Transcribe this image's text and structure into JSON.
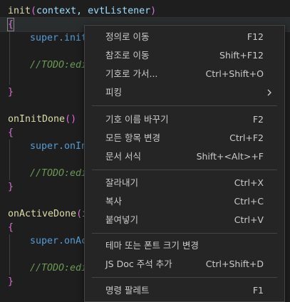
{
  "code": {
    "l1": {
      "name": "init",
      "open": "(",
      "args": "context, evtListener",
      "close": ")"
    },
    "l2": {
      "brace": "{"
    },
    "l3": {
      "text": "super.init"
    },
    "l4": {
      "text": "//TODO:edi"
    },
    "l5": {
      "brace": "}"
    },
    "l6": {
      "name": "onInitDone",
      "parens": "()"
    },
    "l7": {
      "brace": "{"
    },
    "l8": {
      "text": "super.onIn"
    },
    "l9": {
      "text": "//TODO:edi"
    },
    "l10": {
      "brace": "}"
    },
    "l11": {
      "name": "onActiveDone",
      "open": "(",
      "args": "i"
    },
    "l12": {
      "brace": "{"
    },
    "l13": {
      "text": "super.onAc"
    },
    "l14": {
      "text": "//TODO:edi"
    },
    "l15": {
      "brace": "}"
    }
  },
  "context_menu": {
    "items": [
      {
        "label": "정의로 이동",
        "shortcut": "F12"
      },
      {
        "label": "참조로 이동",
        "shortcut": "Shift+F12"
      },
      {
        "label": "기호로 가서...",
        "shortcut": "Ctrl+Shift+O"
      },
      {
        "label": "피킹",
        "shortcut": "",
        "submenu_icon": "chevron-right-icon"
      },
      {
        "label": "기호 이름 바꾸기",
        "shortcut": "F2"
      },
      {
        "label": "모든 항목 변경",
        "shortcut": "Ctrl+F2"
      },
      {
        "label": "문서 서식",
        "shortcut": "Shift+<Alt>+F"
      },
      {
        "label": "잘라내기",
        "shortcut": "Ctrl+X"
      },
      {
        "label": "복사",
        "shortcut": "Ctrl+C"
      },
      {
        "label": "붙여넣기",
        "shortcut": "Ctrl+V"
      },
      {
        "label": "테마 또는 폰트 크기 변경",
        "shortcut": ""
      },
      {
        "label": "JS Doc 주석 추가",
        "shortcut": "Ctrl+Shift+D"
      },
      {
        "label": "명령 팔레트",
        "shortcut": "F1"
      }
    ]
  },
  "colors": {
    "background": "#1e1e1e",
    "menu_background": "#252526",
    "function": "#dcdcaa",
    "comment": "#6a9955",
    "keyword": "#569cd6"
  }
}
